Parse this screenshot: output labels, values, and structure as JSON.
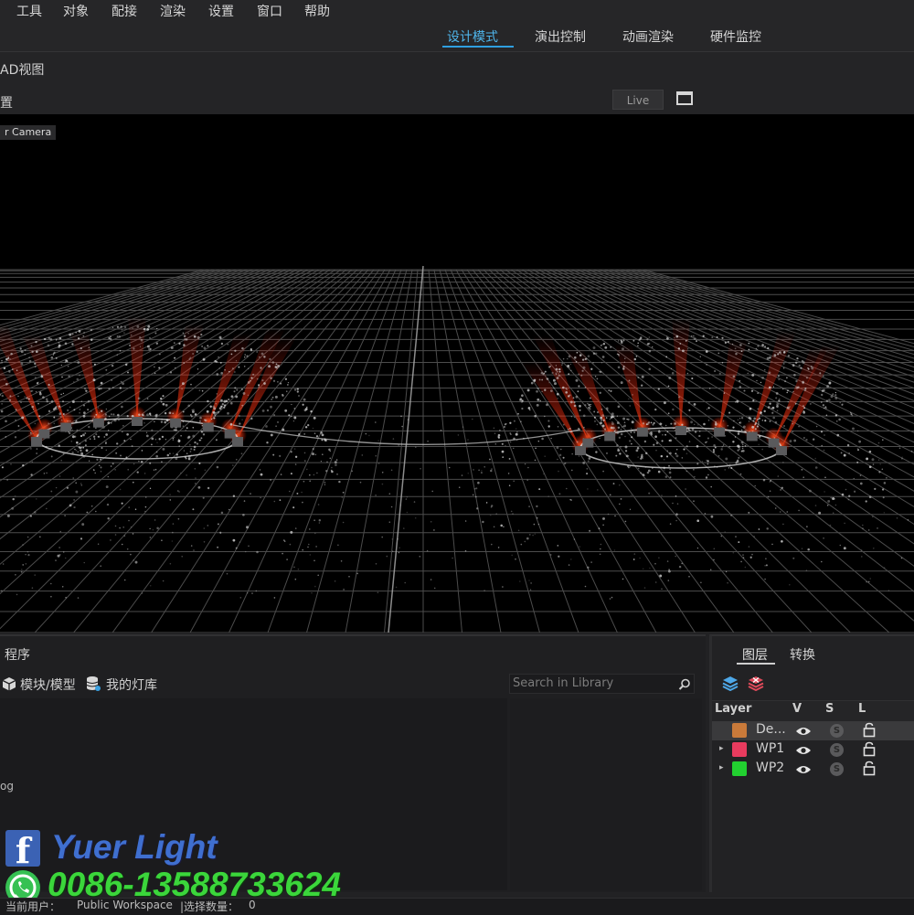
{
  "menu": [
    "工具",
    "对象",
    "配接",
    "渲染",
    "设置",
    "窗口",
    "帮助"
  ],
  "mode_tabs": [
    {
      "label": "设计模式",
      "active": true
    },
    {
      "label": "演出控制",
      "active": false
    },
    {
      "label": "动画渲染",
      "active": false
    },
    {
      "label": "硬件监控",
      "active": false
    }
  ],
  "viewport": {
    "title": "AD视图",
    "toolbar_label": "置",
    "live_label": "Live",
    "camera_label": "r Camera",
    "icons": {
      "maximize": "window-maximize-icon"
    }
  },
  "program_panel": {
    "title": "程序",
    "tab_models": "模块/模型",
    "tab_library": "我的灯库",
    "search_placeholder": "Search in Library",
    "list_item": "og",
    "icons": {
      "models": "cube-icon",
      "library": "database-icon",
      "search": "search-icon"
    }
  },
  "layer_panel": {
    "tab_layers": "图层",
    "tab_convert": "转换",
    "columns": {
      "layer": "Layer",
      "v": "V",
      "s": "S",
      "l": "L"
    },
    "solo_glyph": "S",
    "rows": [
      {
        "name": "De...",
        "color": "#c97a3a",
        "expandable": false,
        "selected": true
      },
      {
        "name": "WP1",
        "color": "#e83b5e",
        "expandable": true,
        "selected": false
      },
      {
        "name": "WP2",
        "color": "#22d030",
        "expandable": true,
        "selected": false
      }
    ],
    "icons": {
      "add_layer": "layers-add-icon",
      "remove_layer": "layers-remove-icon",
      "visible": "eye-icon",
      "solo": "solo-icon",
      "lock": "unlock-icon"
    }
  },
  "status": {
    "user_label": "当前用户：",
    "user_value": "Public Workspace",
    "selection_label": "|选择数量：",
    "selection_value": "0"
  },
  "watermark": {
    "brand": "Yuer Light",
    "phone": "0086-13588733624",
    "fb_glyph": "f",
    "icons": {
      "facebook": "facebook-icon",
      "whatsapp": "whatsapp-icon"
    }
  },
  "colors": {
    "accent": "#4fb6ec",
    "beam": "#ff3010"
  }
}
